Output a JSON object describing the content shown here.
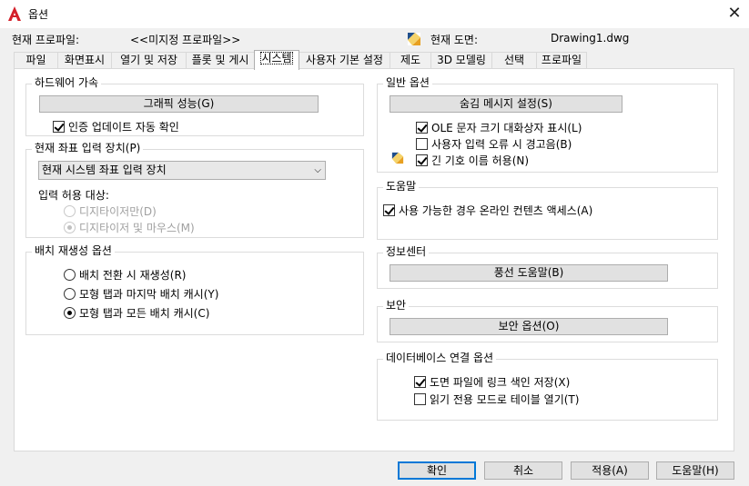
{
  "window": {
    "title": "옵션",
    "close_glyph": "✕"
  },
  "header": {
    "profile_label": "현재 프로파일:",
    "profile_value": "<<미지정 프로파일>>",
    "drawing_label": "현재 도면:",
    "drawing_value": "Drawing1.dwg"
  },
  "tabs": [
    {
      "label": "파일"
    },
    {
      "label": "화면표시"
    },
    {
      "label": "열기 및 저장"
    },
    {
      "label": "플롯 및 게시"
    },
    {
      "label": "시스템"
    },
    {
      "label": "사용자 기본 설정"
    },
    {
      "label": "제도"
    },
    {
      "label": "3D 모델링"
    },
    {
      "label": "선택"
    },
    {
      "label": "프로파일"
    }
  ],
  "active_tab": "시스템",
  "hardware": {
    "title": "하드웨어 가속",
    "graphics_button": "그래픽 성능(G)",
    "verify_updates": "인증 업데이트 자동 확인",
    "verify_updates_checked": true
  },
  "pointing": {
    "title": "현재 좌표 입력 장치(P)",
    "device_value": "현재 시스템 좌표 입력 장치",
    "accept_label": "입력 허용 대상:",
    "digitizer_only": "디지타이저만(D)",
    "digitizer_and_mouse": "디지타이저 및 마우스(M)"
  },
  "layout_regen": {
    "title": "배치 재생성 옵션",
    "opt1": "배치 전환 시 재생성(R)",
    "opt2": "모형 탭과 마지막 배치 캐시(Y)",
    "opt3": "모형 탭과 모든 배치 캐시(C)",
    "selected": 3
  },
  "general": {
    "title": "일반 옵션",
    "hidden_messages_button": "숨김 메시지 설정(S)",
    "ole_text": "OLE 문자 크기 대화상자 표시(L)",
    "ole_checked": true,
    "beep": "사용자 입력 오류 시 경고음(B)",
    "beep_checked": false,
    "long_symbol": "긴 기호 이름 허용(N)",
    "long_symbol_checked": true
  },
  "help": {
    "title": "도움말",
    "online": "사용 가능한 경우 온라인 컨텐츠 액세스(A)",
    "online_checked": true
  },
  "infocenter": {
    "title": "정보센터",
    "balloon_button": "풍선 도움말(B)"
  },
  "security": {
    "title": "보안",
    "security_button": "보안 옵션(O)"
  },
  "dbconnect": {
    "title": "데이터베이스 연결 옵션",
    "store_links": "도면 파일에 링크 색인 저장(X)",
    "store_links_checked": true,
    "readonly_tables": "읽기 전용 모드로 테이블 열기(T)",
    "readonly_tables_checked": false
  },
  "footer": {
    "ok": "확인",
    "cancel": "취소",
    "apply": "적용(A)",
    "help": "도움말(H)"
  },
  "colors": {
    "accent": "#0078d7",
    "app_icon_red": "#d4202a"
  }
}
